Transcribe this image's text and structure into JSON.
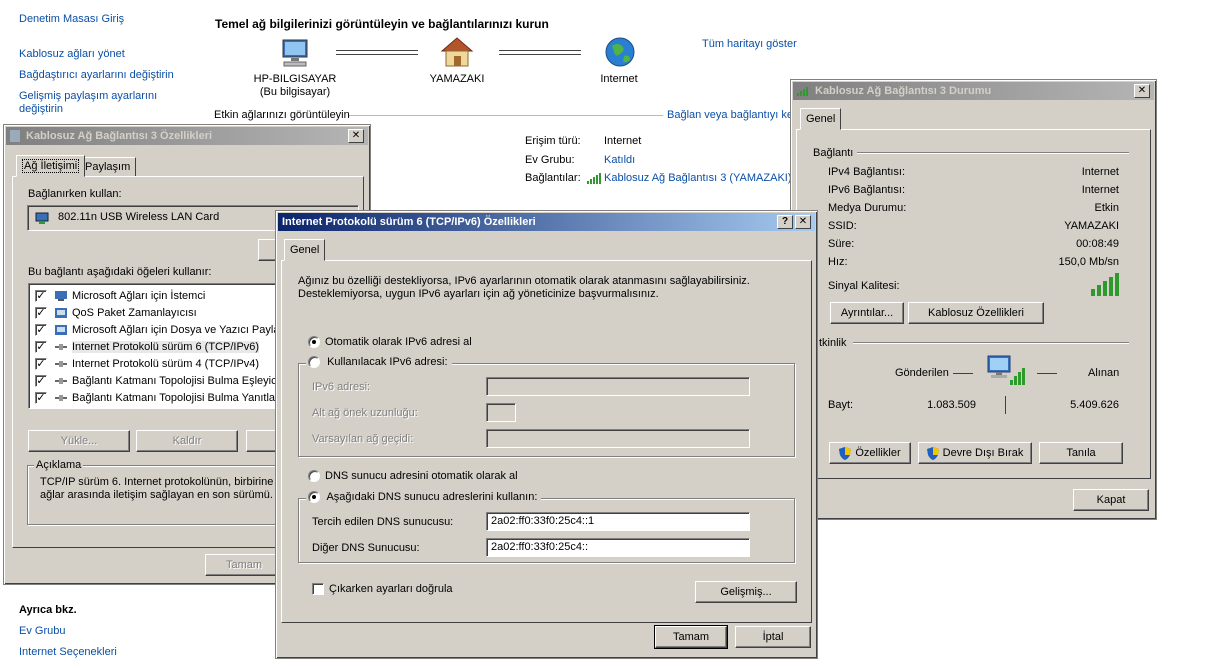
{
  "control_panel": {
    "home_link": "Denetim Masası Giriş",
    "left_links": [
      "Kablosuz ağları yönet",
      "Bağdaştırıcı ayarlarını değiştirin",
      "Gelişmiş paylaşım ayarlarını",
      "değiştirin"
    ],
    "heading": "Temel ağ bilgilerinizi görüntüleyin ve bağlantılarınızı kurun",
    "map_link": "Tüm haritayı göster",
    "nodes": [
      {
        "name": "HP-BILGISAYAR",
        "sub": "(Bu bilgisayar)"
      },
      {
        "name": "YAMAZAKI",
        "sub": ""
      },
      {
        "name": "Internet",
        "sub": ""
      }
    ],
    "active_networks": "Etkin ağlarınızı görüntüleyin",
    "connect_link": "Bağlan veya bağlantıyı ke",
    "access_type_label": "Erişim türü:",
    "access_type_value": "Internet",
    "homegroup_label": "Ev Grubu:",
    "homegroup_value": "Katıldı",
    "connections_label": "Bağlantılar:",
    "connections_value": "Kablosuz Ağ Bağlantısı 3 (YAMAZAKI)",
    "see_also": "Ayrıca bkz.",
    "see_also_links": [
      "Ev Grubu",
      "Internet Seçenekleri"
    ]
  },
  "props_dialog": {
    "title": "Kablosuz Ağ Bağlantısı 3 Özellikleri",
    "tabs": [
      "Ağ İletişimi",
      "Paylaşım"
    ],
    "connect_using_label": "Bağlanırken kullan:",
    "adapter": "802.11n USB Wireless LAN Card",
    "items_label": "Bu bağlantı aşağıdaki öğeleri kullanır:",
    "items": [
      "Microsoft Ağları için İstemci",
      "QoS Paket Zamanlayıcısı",
      "Microsoft Ağları için Dosya ve Yazıcı Paylaş",
      "Internet Protokolü sürüm 6 (TCP/IPv6)",
      "Internet Protokolü sürüm 4 (TCP/IPv4)",
      "Bağlantı Katmanı Topolojisi Bulma Eşleyicisi",
      "Bağlantı Katmanı Topolojisi Bulma Yanıtlayıcı"
    ],
    "install_button": "Yükle...",
    "remove_button": "Kaldır",
    "description_label": "Açıklama",
    "description_text": "TCP/IP sürüm 6. Internet protokolünün, birbirine b​ağlı ağlar arasında iletişim sağlayan en son sürümü.",
    "desc_line1": "TCP/IP sürüm 6. Internet protokolünün, birbirine b",
    "desc_line2": "ağlar arasında iletişim sağlayan en son sürümü.",
    "ok_button": "Tamam"
  },
  "status_dialog": {
    "title": "Kablosuz Ağ Bağlantısı 3 Durumu",
    "tab": "Genel",
    "connection_group": "Bağlantı",
    "rows": [
      {
        "label": "IPv4 Bağlantısı:",
        "value": "Internet"
      },
      {
        "label": "IPv6 Bağlantısı:",
        "value": "Internet"
      },
      {
        "label": "Medya Durumu:",
        "value": "Etkin"
      },
      {
        "label": "SSID:",
        "value": "YAMAZAKI"
      },
      {
        "label": "Süre:",
        "value": "00:08:49"
      },
      {
        "label": "Hız:",
        "value": "150,0 Mb/sn"
      }
    ],
    "signal_label": "Sinyal Kalitesi:",
    "signal_level": 5,
    "details_button": "Ayrıntılar...",
    "wireless_props_button": "Kablosuz Özellikleri",
    "activity_group": "tkinlik",
    "sent_label": "Gönderilen",
    "received_label": "Alınan",
    "bytes_label": "Bayt:",
    "bytes_sent": "1.083.509",
    "bytes_received": "5.409.626",
    "properties_button": "Özellikler",
    "disable_button": "Devre Dışı Bırak",
    "diagnose_button": "Tanıla",
    "close_button": "Kapat"
  },
  "ipv6_dialog": {
    "title": "Internet Protokolü sürüm 6 (TCP/IPv6) Özellikleri",
    "help_button": "?",
    "close_button": "✕",
    "tab": "Genel",
    "intro_line1": "Ağınız bu özelliği destekliyorsa, IPv6 ayarlarının otomatik olarak atanmasını sağlayabilirsiniz.",
    "intro_line2": "Desteklemiyorsa, uygun IPv6 ayarları için ağ yöneticinize başvurmalısınız.",
    "auto_ip": "Otomatik olarak IPv6 adresi al",
    "manual_ip": "Kullanılacak IPv6 adresi:",
    "ip_label": "IPv6 adresi:",
    "prefix_label": "Alt ağ önek uzunluğu:",
    "gateway_label": "Varsayılan ağ geçidi:",
    "auto_dns": "DNS sunucu adresini otomatik olarak al",
    "manual_dns": "Aşağıdaki DNS sunucu adreslerini kullanın:",
    "preferred_dns_label": "Tercih edilen DNS sunucusu:",
    "preferred_dns": "2a02:ff0:33f0:25c4::1",
    "alternate_dns_label": "Diğer DNS Sunucusu:",
    "alternate_dns": "2a02:ff0:33f0:25c4::",
    "validate_label": "Çıkarken ayarları doğrula",
    "advanced_button": "Gelişmiş...",
    "ok_button": "Tamam",
    "cancel_button": "İptal"
  }
}
